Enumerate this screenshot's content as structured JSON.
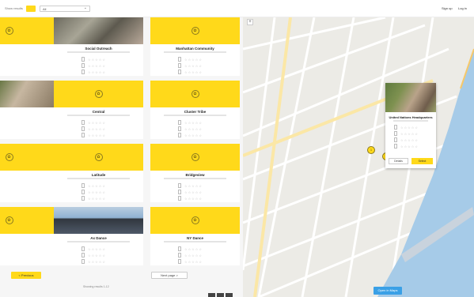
{
  "topbar": {
    "left_label": "Show results",
    "yellow_button": "",
    "filter_value": "All",
    "right_links": [
      "Sign up",
      "Log in"
    ]
  },
  "cards": [
    {
      "title": "ba",
      "image": "logo",
      "left": true
    },
    {
      "title": "Social Outreach",
      "image": "photo"
    },
    {
      "title": "Manhattan Community",
      "image": "logo"
    },
    {
      "title": "Playground",
      "image": "photo3",
      "left": true
    },
    {
      "title": "Central",
      "image": "logo"
    },
    {
      "title": "Cluster Tribe",
      "image": "logo"
    },
    {
      "title": "ball",
      "image": "logo",
      "left": true
    },
    {
      "title": "Latitude",
      "image": "logo"
    },
    {
      "title": "Bridgeview",
      "image": "logo"
    },
    {
      "title": "Gem NY",
      "image": "logo",
      "left": true
    },
    {
      "title": "Ax Dance",
      "image": "photo2"
    },
    {
      "title": "NY Dance",
      "image": "logo"
    }
  ],
  "buttons": {
    "prev": "< Previous",
    "next": "Next page >"
  },
  "pagination_text": "Showing results 1-12",
  "map": {
    "zoom_icon": "plus",
    "popup": {
      "title": "United Nations Headquarters",
      "details_button": "Details",
      "select_button": "Select"
    },
    "pins": [
      "1",
      "2"
    ],
    "bottom_button": "Open in Maps"
  },
  "colors": {
    "accent": "#ffd91a",
    "map_water": "#a6cbe8",
    "map_land": "#ecebe6",
    "map_button": "#3aa0e6"
  }
}
